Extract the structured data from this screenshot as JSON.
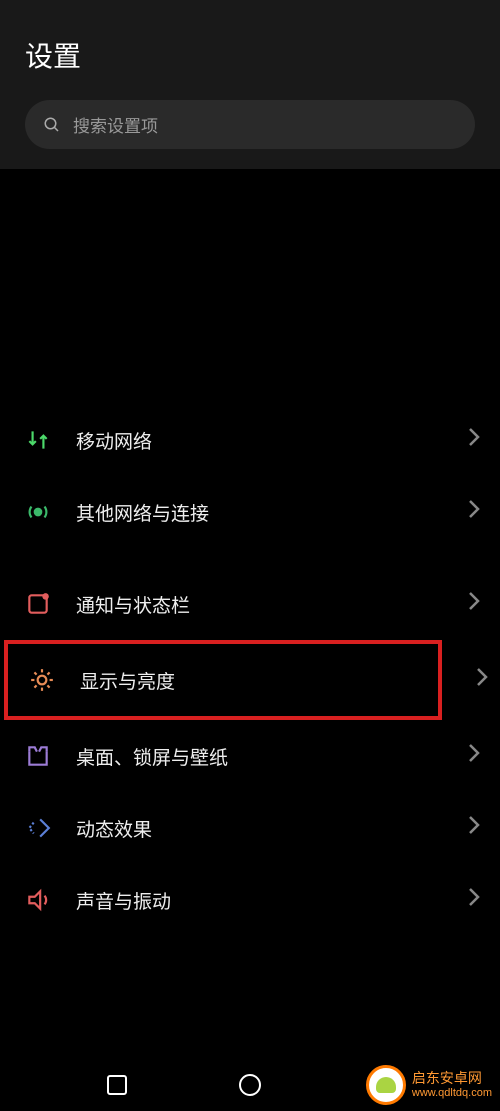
{
  "page": {
    "title": "设置"
  },
  "search": {
    "placeholder": "搜索设置项"
  },
  "sections": [
    {
      "items": [
        {
          "label": "移动网络",
          "icon": "mobile-network-icon",
          "color": "#4cd96a"
        },
        {
          "label": "其他网络与连接",
          "icon": "other-network-icon",
          "color": "#3bb96a"
        }
      ]
    },
    {
      "items": [
        {
          "label": "通知与状态栏",
          "icon": "notification-icon",
          "color": "#e25d5d"
        },
        {
          "label": "显示与亮度",
          "icon": "brightness-icon",
          "color": "#e88c56",
          "highlighted": true
        },
        {
          "label": "桌面、锁屏与壁纸",
          "icon": "desktop-icon",
          "color": "#9c7cd6"
        },
        {
          "label": "动态效果",
          "icon": "animation-icon",
          "color": "#5b7fd6"
        },
        {
          "label": "声音与振动",
          "icon": "sound-icon",
          "color": "#e25d5d"
        }
      ]
    }
  ],
  "watermark": {
    "title": "启东安卓网",
    "url": "www.qdltdq.com"
  }
}
